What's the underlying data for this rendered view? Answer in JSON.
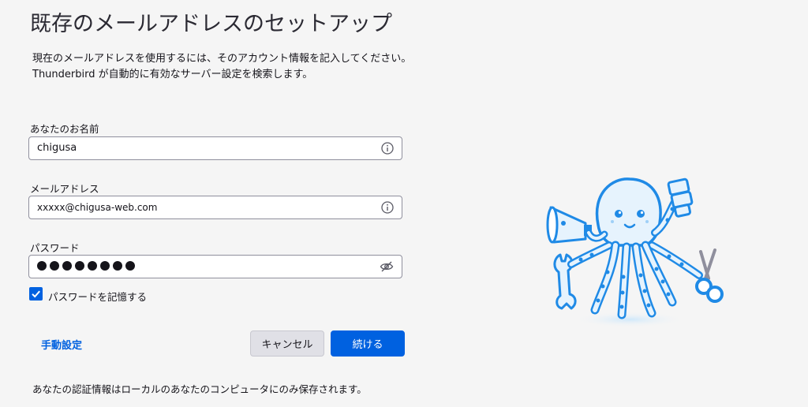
{
  "header": {
    "title": "既存のメールアドレスのセットアップ",
    "subtitle_line1": "現在のメールアドレスを使用するには、そのアカウント情報を記入してください。",
    "subtitle_line2": "Thunderbird が自動的に有効なサーバー設定を検索します。"
  },
  "form": {
    "name_label": "あなたのお名前",
    "name_value": "chigusa",
    "email_label": "メールアドレス",
    "email_value": "xxxxx@chigusa-web.com",
    "password_label": "パスワード",
    "password_mask_count": 8,
    "remember_password_label": "パスワードを記憶する",
    "remember_password_checked": true
  },
  "actions": {
    "manual_config_label": "手動設定",
    "cancel_label": "キャンセル",
    "continue_label": "続ける"
  },
  "footer": {
    "note": "あなたの認証情報はローカルのあなたのコンピュータにのみ保存されます。"
  },
  "colors": {
    "accent": "#0061e0",
    "mascot_outline": "#1f8ae6",
    "mascot_fill": "#e6f3fd"
  },
  "icons": {
    "name_field_icon": "info-icon",
    "email_field_icon": "info-icon",
    "password_field_icon": "eye-slash-icon",
    "checkbox_icon": "checkmark-icon",
    "illustration": "octopus-mascot"
  }
}
